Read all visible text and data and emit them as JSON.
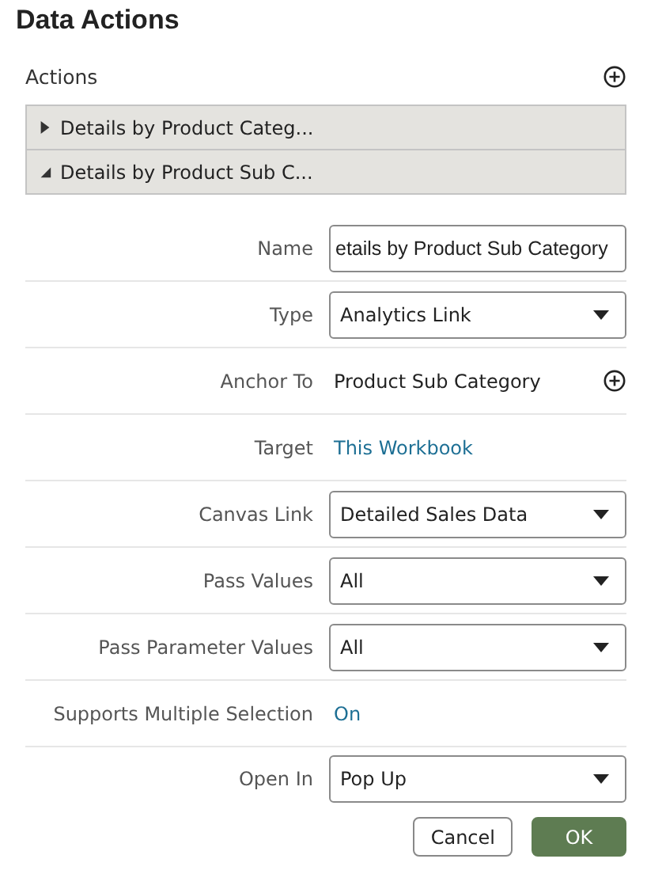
{
  "title": "Data Actions",
  "actions": {
    "label": "Actions",
    "items": [
      {
        "label": "Details by Product Categ...",
        "expanded": false
      },
      {
        "label": "Details by Product Sub C...",
        "expanded": true
      }
    ]
  },
  "fields": [
    {
      "kind": "input",
      "label": "Name",
      "value": "etails by Product Sub Category"
    },
    {
      "kind": "select",
      "label": "Type",
      "value": "Analytics Link"
    },
    {
      "kind": "text_add",
      "label": "Anchor To",
      "value": "Product Sub Category"
    },
    {
      "kind": "link",
      "label": "Target",
      "value": "This Workbook"
    },
    {
      "kind": "select",
      "label": "Canvas Link",
      "value": "Detailed Sales Data"
    },
    {
      "kind": "select",
      "label": "Pass Values",
      "value": "All"
    },
    {
      "kind": "select",
      "label": "Pass Parameter Values",
      "value": "All"
    },
    {
      "kind": "link",
      "label": "Supports Multiple Selection",
      "value": "On"
    },
    {
      "kind": "select",
      "label": "Open In",
      "value": "Pop Up"
    }
  ],
  "buttons": [
    {
      "label": "Cancel",
      "kind": "secondary"
    },
    {
      "label": "OK",
      "kind": "primary"
    }
  ]
}
